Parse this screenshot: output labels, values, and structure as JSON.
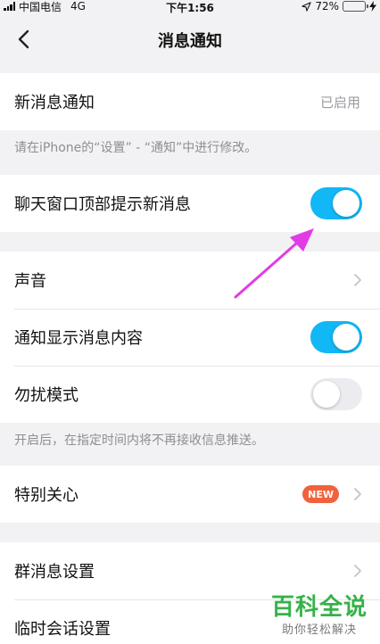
{
  "status_bar": {
    "carrier": "中国电信",
    "network": "4G",
    "time": "下午1:56",
    "battery": "72%",
    "battery_level": 0.72
  },
  "header": {
    "title": "消息通知"
  },
  "new_message": {
    "label": "新消息通知",
    "value": "已启用"
  },
  "notes": {
    "iphone_settings": "请在iPhone的“设置” - “通知”中进行修改。",
    "dnd": "开启后，在指定时间内将不再接收信息推送。"
  },
  "chat_top": {
    "label": "聊天窗口顶部提示新消息",
    "enabled": true
  },
  "sound": {
    "label": "声音"
  },
  "show_content": {
    "label": "通知显示消息内容",
    "enabled": true
  },
  "dnd": {
    "label": "勿扰模式",
    "enabled": false
  },
  "special": {
    "label": "特别关心",
    "badge": "NEW"
  },
  "group": {
    "label": "群消息设置"
  },
  "temp": {
    "label": "临时会话设置"
  },
  "watermark": {
    "title": "百科全说",
    "subtitle": "助你轻松解决"
  },
  "colors": {
    "toggle_on": "#12b7f5",
    "arrow": "#e23be6",
    "badge": "#f0623d"
  }
}
